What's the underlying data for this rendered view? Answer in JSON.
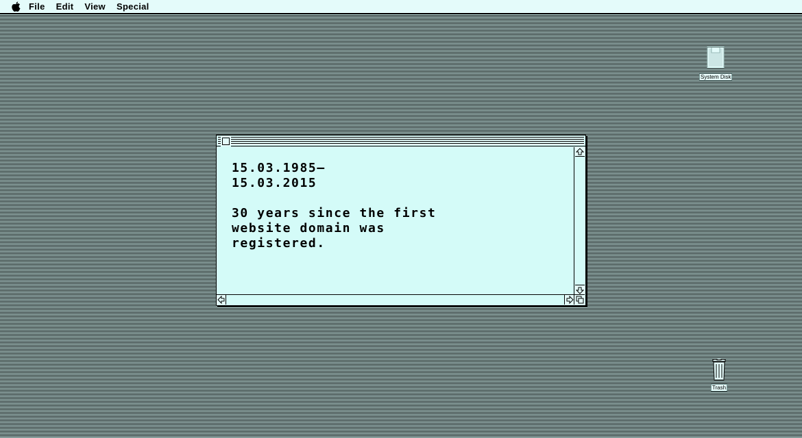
{
  "menubar": {
    "apple_icon": "apple-icon",
    "items": [
      "File",
      "Edit",
      "View",
      "Special"
    ]
  },
  "desktop": {
    "disk": {
      "label": "System Disk",
      "icon": "floppy-disk-icon"
    },
    "trash": {
      "label": "Trash",
      "icon": "trash-can-icon"
    }
  },
  "window": {
    "title": "",
    "lines": [
      "15.03.1985–",
      "15.03.2015",
      "",
      "30 years since the first",
      "website domain was",
      "registered."
    ]
  },
  "colors": {
    "desktop_bg": "#d7fbf8",
    "window_bg": "#d4fbf8",
    "ink": "#000000"
  }
}
